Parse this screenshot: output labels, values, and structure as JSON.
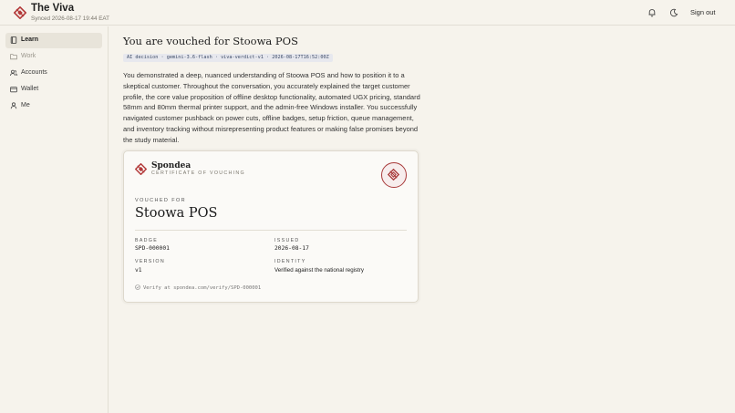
{
  "app": {
    "title": "The Viva",
    "sync_status": "Synced 2026-08-17 19:44 EAT",
    "sign_out_label": "Sign out",
    "accent_color": "#b33a3a"
  },
  "header_icons": [
    "bell-icon",
    "moon-icon"
  ],
  "sidebar": {
    "items": [
      {
        "label": "Learn",
        "icon": "book-icon",
        "active": true
      },
      {
        "label": "Work",
        "icon": "folder-icon",
        "active": false
      },
      {
        "label": "Accounts",
        "icon": "users-icon",
        "active": false
      },
      {
        "label": "Wallet",
        "icon": "wallet-icon",
        "active": false
      },
      {
        "label": "Me",
        "icon": "user-icon",
        "active": false
      }
    ]
  },
  "main": {
    "title": "You are vouched for Stoowa POS",
    "meta": "AI decision · gemini-3.6-flash · viva-verdict-v1 · 2026-08-17T16:52:00Z",
    "summary": "You demonstrated a deep, nuanced understanding of Stoowa POS and how to position it to a skeptical customer. Throughout the conversation, you accurately explained the target customer profile, the core value proposition of offline desktop functionality, automated UGX pricing, standard 58mm and 80mm thermal printer support, and the admin-free Windows installer. You successfully navigated customer pushback on power cuts, offline badges, setup friction, queue management, and inventory tracking without misrepresenting product features or making false promises beyond the study material."
  },
  "certificate": {
    "brand": "Spondea",
    "subtitle": "CERTIFICATE OF VOUCHING",
    "vouched_for_label": "VOUCHED FOR",
    "product": "Stoowa POS",
    "badge_label": "BADGE",
    "badge_value": "SPD-000001",
    "issued_label": "ISSUED",
    "issued_value": "2026-08-17",
    "version_label": "VERSION",
    "version_value": "v1",
    "identity_label": "IDENTITY",
    "identity_value": "Verified against the national registry",
    "verify_text": "Verify at spondea.com/verify/SPD-000001"
  }
}
